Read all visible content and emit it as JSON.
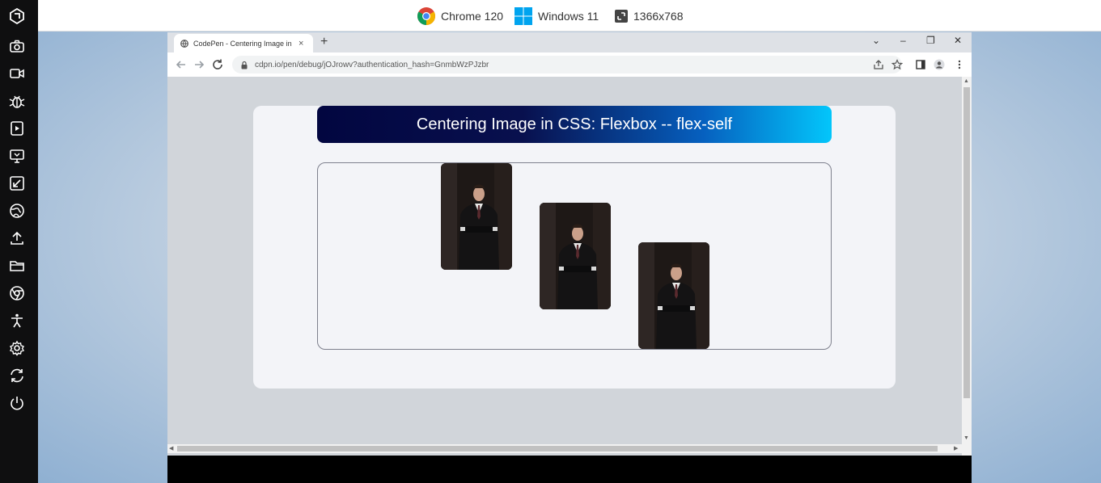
{
  "topbar": {
    "browser_label": "Chrome 120",
    "os_label": "Windows 11",
    "resolution_label": "1366x768"
  },
  "sidebar": {
    "icons": [
      "logo-icon",
      "camera-icon",
      "video-icon",
      "bug-icon",
      "play-screen-icon",
      "monitor-icon",
      "resize-icon",
      "globe-icon",
      "upload-icon",
      "folder-icon",
      "chrome-icon",
      "accessibility-icon",
      "settings-icon",
      "sync-icon",
      "power-icon"
    ]
  },
  "browser": {
    "tab_title": "CodePen - Centering Image in C",
    "tab_close": "×",
    "new_tab": "+",
    "url": "cdpn.io/pen/debug/jOJrowv?authentication_hash=GnmbWzPJzbr",
    "window_controls": [
      "⌄",
      "–",
      "❐",
      "✕"
    ]
  },
  "page": {
    "heading": "Centering Image in CSS: Flexbox -- flex-self",
    "images": [
      {
        "alt": "man in suit photo 1"
      },
      {
        "alt": "man in suit photo 2"
      },
      {
        "alt": "man in suit photo 3"
      }
    ]
  },
  "colors": {
    "heading_gradient_start": "#020640",
    "heading_gradient_end": "#03c6fb",
    "card_bg": "#f3f4f8",
    "viewport_bg": "#d1d5da"
  }
}
